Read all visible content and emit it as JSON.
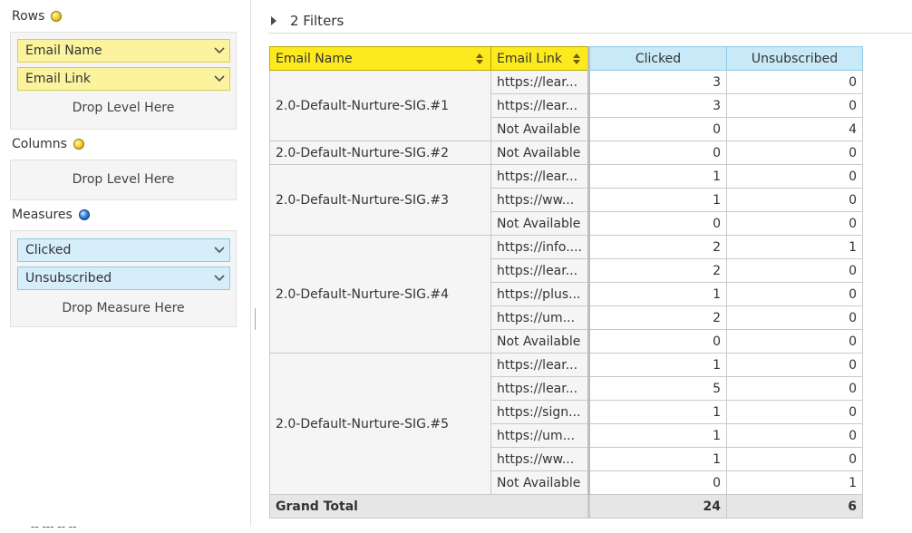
{
  "pivot_config": {
    "rows_label": "Rows",
    "rows_items": [
      "Email Name",
      "Email Link"
    ],
    "rows_drop": "Drop Level Here",
    "columns_label": "Columns",
    "columns_drop": "Drop Level Here",
    "measures_label": "Measures",
    "measures_items": [
      "Clicked",
      "Unsubscribed"
    ],
    "measures_drop": "Drop Measure Here",
    "cutoff_text": "-- --- -- --"
  },
  "filters": {
    "label": "2 Filters"
  },
  "table": {
    "headers": {
      "email_name": "Email Name",
      "email_link": "Email Link",
      "clicked": "Clicked",
      "unsubscribed": "Unsubscribed"
    },
    "groups": [
      {
        "name": "2.0-Default-Nurture-SIG.#1",
        "rows": [
          {
            "link": "https://lear...",
            "clicked": "3",
            "unsubscribed": "0"
          },
          {
            "link": "https://lear...",
            "clicked": "3",
            "unsubscribed": "0"
          },
          {
            "link": "Not Available",
            "clicked": "0",
            "unsubscribed": "4"
          }
        ]
      },
      {
        "name": "2.0-Default-Nurture-SIG.#2",
        "rows": [
          {
            "link": "Not Available",
            "clicked": "0",
            "unsubscribed": "0"
          }
        ]
      },
      {
        "name": "2.0-Default-Nurture-SIG.#3",
        "rows": [
          {
            "link": "https://lear...",
            "clicked": "1",
            "unsubscribed": "0"
          },
          {
            "link": "https://ww...",
            "clicked": "1",
            "unsubscribed": "0"
          },
          {
            "link": "Not Available",
            "clicked": "0",
            "unsubscribed": "0"
          }
        ]
      },
      {
        "name": "2.0-Default-Nurture-SIG.#4",
        "rows": [
          {
            "link": "https://info....",
            "clicked": "2",
            "unsubscribed": "1"
          },
          {
            "link": "https://lear...",
            "clicked": "2",
            "unsubscribed": "0"
          },
          {
            "link": "https://plus...",
            "clicked": "1",
            "unsubscribed": "0"
          },
          {
            "link": "https://um...",
            "clicked": "2",
            "unsubscribed": "0"
          },
          {
            "link": "Not Available",
            "clicked": "0",
            "unsubscribed": "0"
          }
        ]
      },
      {
        "name": "2.0-Default-Nurture-SIG.#5",
        "rows": [
          {
            "link": "https://lear...",
            "clicked": "1",
            "unsubscribed": "0"
          },
          {
            "link": "https://lear...",
            "clicked": "5",
            "unsubscribed": "0"
          },
          {
            "link": "https://sign...",
            "clicked": "1",
            "unsubscribed": "0"
          },
          {
            "link": "https://um...",
            "clicked": "1",
            "unsubscribed": "0"
          },
          {
            "link": "https://ww...",
            "clicked": "1",
            "unsubscribed": "0"
          },
          {
            "link": "Not Available",
            "clicked": "0",
            "unsubscribed": "1"
          }
        ]
      }
    ],
    "grand_total": {
      "label": "Grand Total",
      "clicked": "24",
      "unsubscribed": "6"
    }
  },
  "colors": {
    "row_header_yellow": "#fdea1e",
    "measure_header_blue": "#c8e9f7",
    "row_pill_yellow": "#fbf39e",
    "measure_pill_blue": "#d5eefa"
  }
}
